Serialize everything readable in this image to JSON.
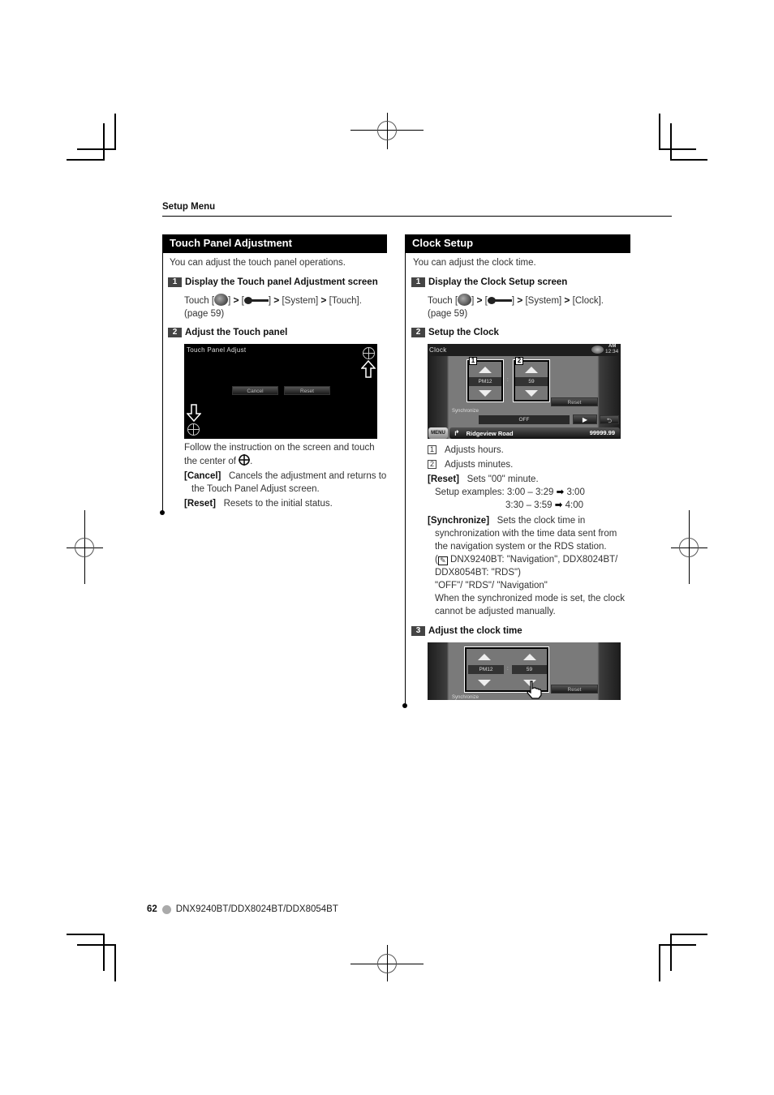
{
  "header": {
    "section": "Setup Menu"
  },
  "touch_panel": {
    "title": "Touch Panel Adjustment",
    "intro": "You can adjust the touch panel operations.",
    "step1": {
      "num": "1",
      "title": "Display the Touch panel Adjustment screen",
      "touch_prefix": "Touch [",
      "sep1": "] ",
      "gt": ">",
      "bracket_open": " [",
      "system": "[System]",
      "touch_target": "[Touch].",
      "page_ref": "(page 59)"
    },
    "step2": {
      "num": "2",
      "title": "Adjust the Touch panel"
    },
    "screen": {
      "title": "Touch Panel Adjust",
      "cancel": "Cancel",
      "reset": "Reset"
    },
    "follow_text": "Follow the instruction on the screen and touch the center of",
    "period": ".",
    "cancel_label": "[Cancel]",
    "cancel_desc": "Cancels the adjustment and returns to the Touch Panel Adjust screen.",
    "reset_label": "[Reset]",
    "reset_desc": "Resets to the initial status."
  },
  "clock": {
    "title": "Clock Setup",
    "intro": "You can adjust the clock time.",
    "step1": {
      "num": "1",
      "title": "Display the Clock Setup screen",
      "touch_prefix": "Touch [",
      "system": "[System]",
      "clock_target": "[Clock].",
      "page_ref": "(page 59)"
    },
    "step2": {
      "num": "2",
      "title": "Setup the Clock"
    },
    "screen": {
      "title": "Clock",
      "ampm": "AM",
      "time": "12:34",
      "hour_value": "PM12",
      "colon": ":",
      "minute_value": "59",
      "tag1": "1",
      "tag2": "2",
      "reset": "Reset",
      "synchronize": "Synchronize",
      "sync_value": "OFF",
      "menu": "MENU",
      "road": "Ridgeview Road",
      "distance": "99999.99"
    },
    "item1_num": "1",
    "item1": "Adjusts hours.",
    "item2_num": "2",
    "item2": "Adjusts minutes.",
    "reset_label": "[Reset]",
    "reset_desc": "Sets \"00\" minute.",
    "setup_examples_label": "Setup examples: 3:00 – 3:29",
    "example1_result": "3:00",
    "example2_range": "3:30 – 3:59",
    "example2_result": "4:00",
    "sync_label": "[Synchronize]",
    "sync_desc_1": "Sets the clock time in",
    "sync_desc_2": "synchronization with the time data sent from",
    "sync_desc_3": "the navigation system or the RDS station.",
    "sync_note_1": "DNX9240BT: \"Navigation\", DDX8024BT/",
    "sync_note_2": "DDX8054BT: \"RDS\")",
    "sync_options": "\"OFF\"/ \"RDS\"/ \"Navigation\"",
    "sync_warn_1": "When the synchronized mode is set, the clock",
    "sync_warn_2": "cannot be adjusted manually.",
    "step3": {
      "num": "3",
      "title": "Adjust the clock time"
    },
    "screen3": {
      "hour_value": "PM12",
      "colon": ":",
      "minute_value": "59",
      "reset": "Reset",
      "synchronize": "Synchronize"
    }
  },
  "footer": {
    "page_number": "62",
    "models": "DNX9240BT/DDX8024BT/DDX8054BT"
  }
}
